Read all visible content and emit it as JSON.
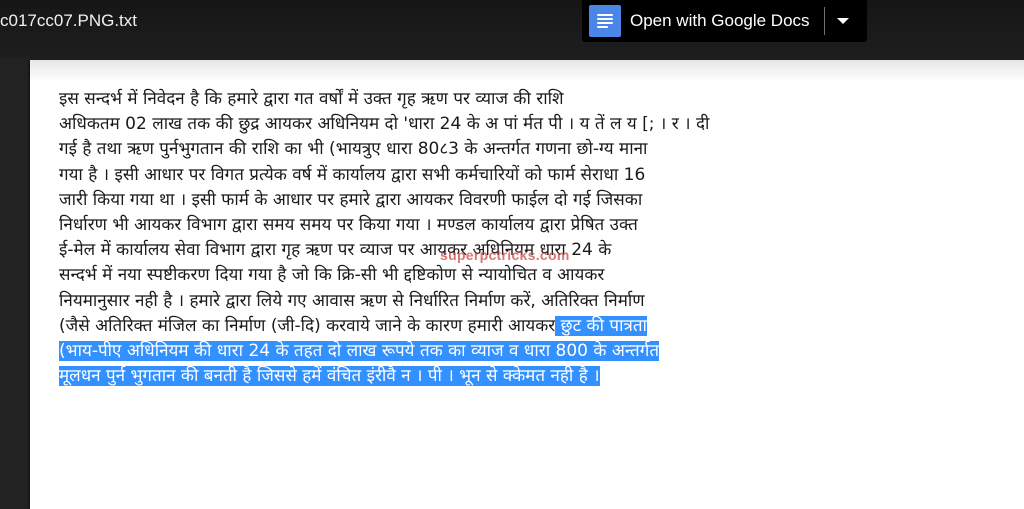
{
  "header": {
    "file_name": "c017cc07.PNG.txt",
    "open_with_label": "Open with Google Docs",
    "docs_icon": "google-docs-icon",
    "dropdown_icon": "caret-down-icon"
  },
  "document": {
    "lines": [
      "इस सन्दर्भ में निवेदन है कि हमारे द्वारा गत वर्षों में उक्त गृह ऋण पर व्याज की राशि",
      "अधिकतम 02 लाख तक की छुद्र आयकर अधिनियम दो 'धारा 24 के अ पां र्मत पी । य तें ल य [; । र । दी",
      "गई है तथा ऋण पुर्नभुगतान की राशि का भी (भायत्रुए धारा 80८3 के अन्तर्गत गणना छो-ग्य माना",
      "गया है । इसी आधार पर विगत प्रत्येक वर्ष में कार्यालय द्वारा सभी कर्मचारियों को फार्म सेराधा 16",
      "जारी किया गया था । इसी फार्म के आधार पर हमारे द्वारा आयकर विवरणी फाईल दो गई जिसका",
      "निर्धारण भी आयकर विभाग द्वारा समय समय पर किया गया । मण्डल कार्यालय द्वारा प्रेषित उक्त",
      "ई-मेल में कार्यालय सेवा विभाग द्वारा गृह ऋण पर व्याज पर आयकर अधिनियम धारा 24 के",
      "सन्दर्भ में नया स्पष्टीकरण दिया गया है जो कि क्रि-सी भी द्दष्टिकोण से न्यायोचित व आयकर",
      "नियमानुसार नही है । हमारे द्वारा लिये गए आवास ऋण से निर्धारित निर्माण करें, अतिरिक्त निर्माण"
    ],
    "line10_plain": "(जैसे अतिरिक्त मंजिल का निर्माण (जी-दि) करवाये जाने के कारण हमारी आयकर",
    "line10_selected": " छुट की पात्रता ",
    "selected_lines": [
      "(भाय-पीए अधिनियम की धारा 24 के तहत दो लाख रूपये तक का व्याज व धारा 800 के अन्तर्गत ",
      "मूलधन पुर्न भुगतान की बनती है जिससे हमें वंचित इंरीवै न । पी । भून से क्केमत नही है । "
    ],
    "watermark": "superpctricks.com"
  },
  "colors": {
    "selection": "#3390ff",
    "docs_icon": "#4a86e8",
    "background": "#222222"
  }
}
